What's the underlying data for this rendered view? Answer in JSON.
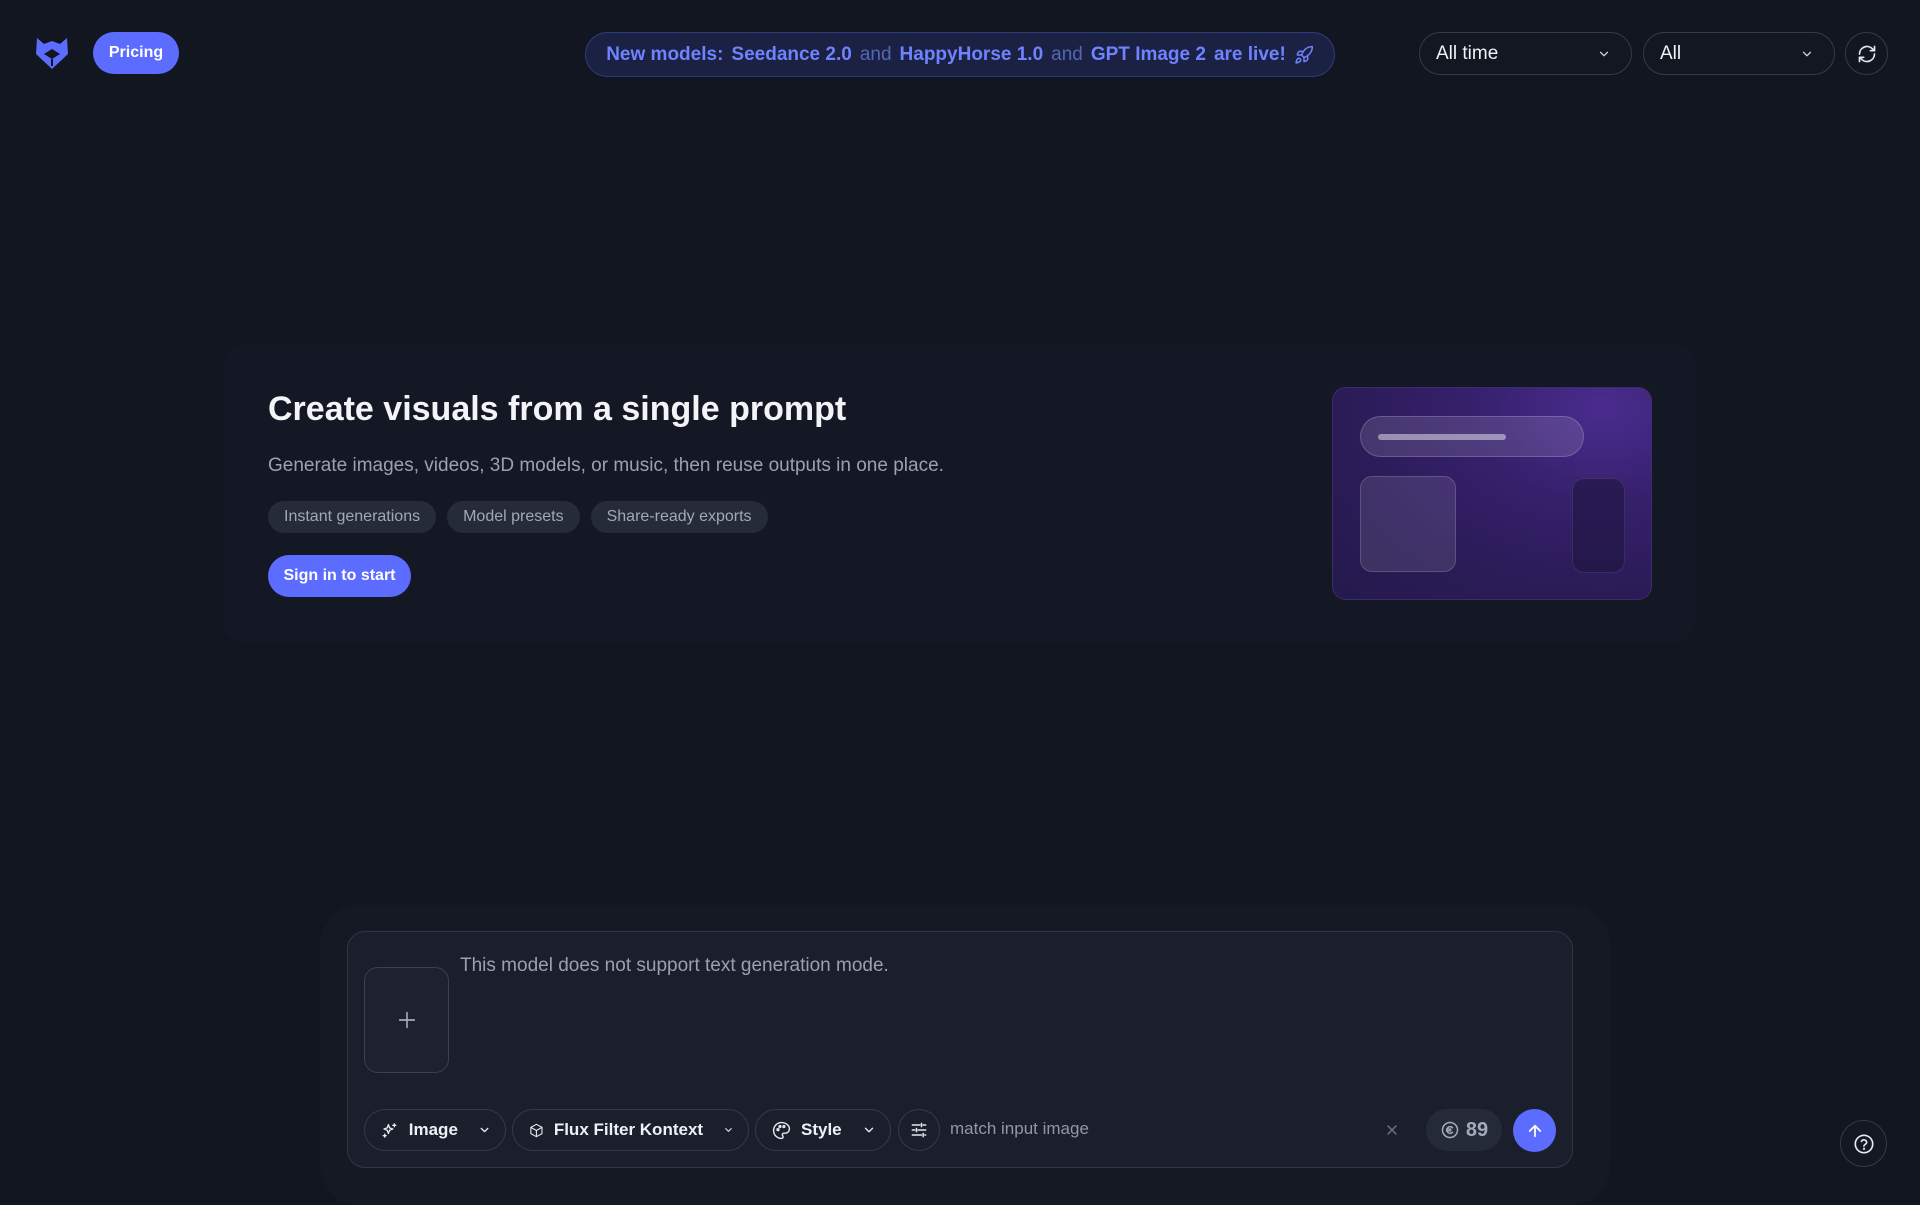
{
  "header": {
    "logo_icon": "hexagon-cat-logo-icon",
    "pricing_label": "Pricing",
    "announcement": {
      "prefix": "New models:",
      "model_1": "Seedance 2.0",
      "and_1": "and",
      "model_2": "HappyHorse 1.0",
      "and_2": "and",
      "model_3": "GPT Image 2",
      "suffix": "are live!",
      "icon": "rocket-icon"
    },
    "time_filter": {
      "value": "All time",
      "icon": "chevron-down-icon"
    },
    "type_filter": {
      "value": "All",
      "icon": "chevron-down-icon"
    },
    "refresh_icon": "refresh-icon"
  },
  "hero": {
    "title": "Create visuals from a single prompt",
    "subtitle": "Generate images, videos, 3D models, or music, then reuse outputs in one place.",
    "chips": [
      "Instant generations",
      "Model presets",
      "Share-ready exports"
    ],
    "cta_label": "Sign in to start"
  },
  "composer": {
    "placeholder": "This model does not support text generation mode.",
    "add_icon": "plus-icon",
    "mode": {
      "label": "Image",
      "icon": "sparkles-icon"
    },
    "model": {
      "label": "Flux Filter Kontext",
      "icon": "cube-icon"
    },
    "style": {
      "label": "Style",
      "icon": "palette-icon"
    },
    "settings_icon": "sliders-icon",
    "hint": "match input image",
    "credits": "89",
    "credits_icon": "coin-icon",
    "send_icon": "arrow-up-icon"
  },
  "help_icon": "help-icon",
  "colors": {
    "background": "#121620",
    "accent": "#5b6cff",
    "announcement_text": "#6f83ff"
  }
}
